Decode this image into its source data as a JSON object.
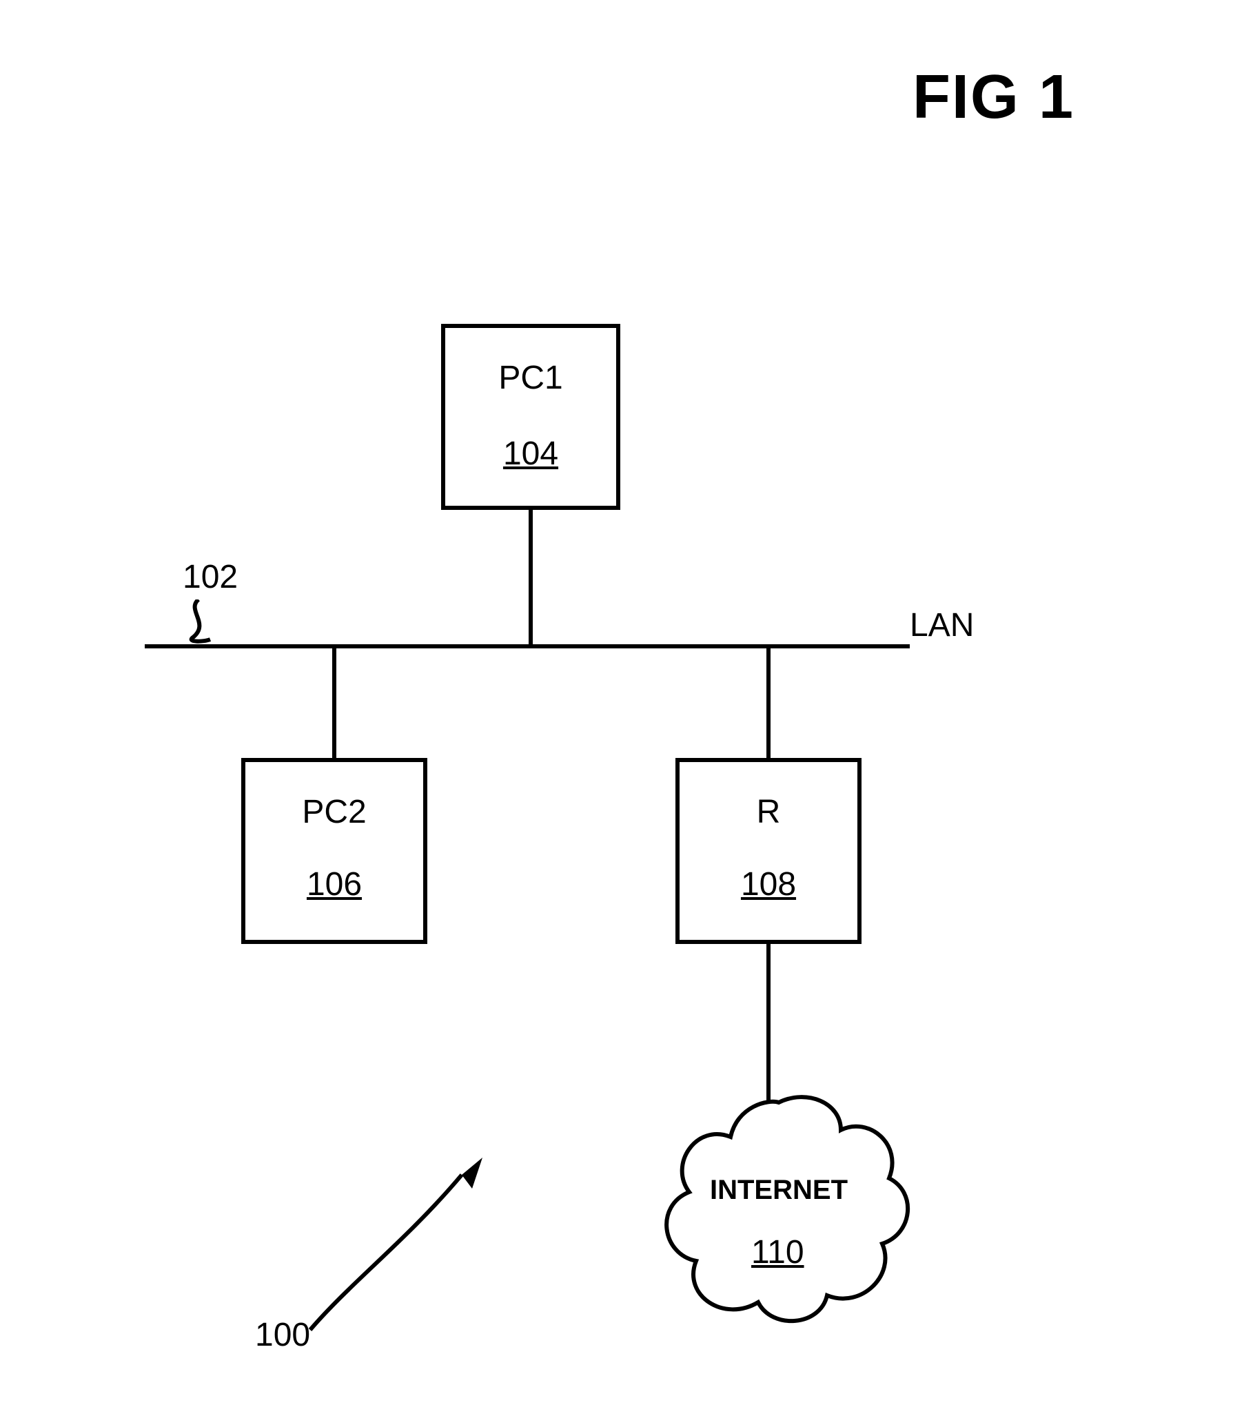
{
  "figure": {
    "title": "FIG 1"
  },
  "nodes": {
    "pc1": {
      "label": "PC1",
      "ref": "104"
    },
    "pc2": {
      "label": "PC2",
      "ref": "106"
    },
    "router": {
      "label": "R",
      "ref": "108"
    },
    "internet": {
      "label": "INTERNET",
      "ref": "110"
    }
  },
  "bus": {
    "label": "LAN",
    "ref": "102"
  },
  "system_ref": "100"
}
